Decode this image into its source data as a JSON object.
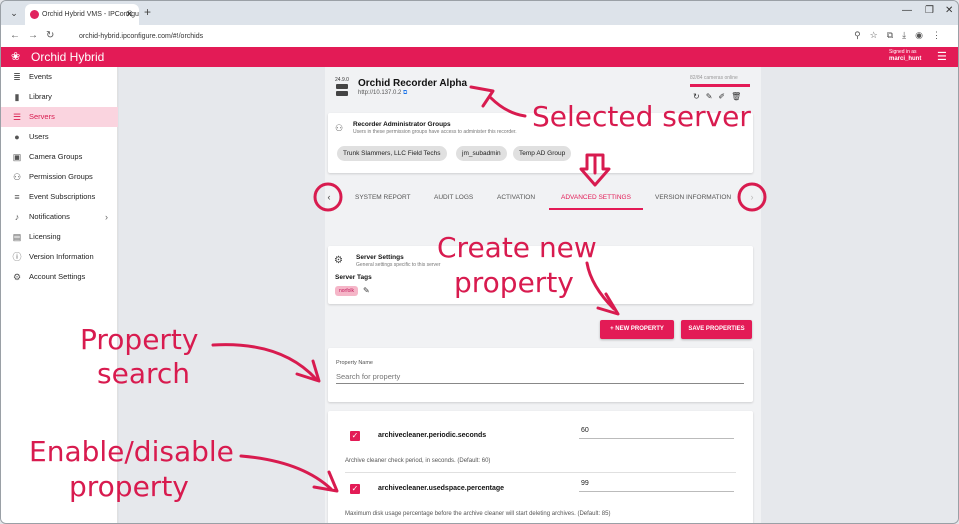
{
  "browser": {
    "tab_title": "Orchid Hybrid VMS - IPConfigu",
    "url": "orchid-hybrid.ipconfigure.com/#!/orchids"
  },
  "app": {
    "title": "Orchid Hybrid",
    "signed_in_label": "Signed in as",
    "user": "marci_hunt"
  },
  "sidebar": {
    "items": [
      {
        "label": "Events",
        "icon": "events-icon"
      },
      {
        "label": "Library",
        "icon": "bookmark-icon"
      },
      {
        "label": "Servers",
        "icon": "servers-icon",
        "active": true
      },
      {
        "label": "Users",
        "icon": "user-icon"
      },
      {
        "label": "Camera Groups",
        "icon": "camera-group-icon"
      },
      {
        "label": "Permission Groups",
        "icon": "permission-group-icon"
      },
      {
        "label": "Event Subscriptions",
        "icon": "event-subscription-icon"
      },
      {
        "label": "Notifications",
        "icon": "bell-icon"
      },
      {
        "label": "Licensing",
        "icon": "license-icon"
      },
      {
        "label": "Version Information",
        "icon": "info-icon"
      },
      {
        "label": "Account Settings",
        "icon": "account-settings-icon"
      }
    ]
  },
  "server": {
    "version": "24.9.0",
    "name": "Orchid Recorder Alpha",
    "url": "http://10.137.0.2",
    "cameras_online": "82/84 cameras online"
  },
  "admin_groups": {
    "title": "Recorder Administrator Groups",
    "subtitle": "Users in these permission groups have access to administer this recorder.",
    "chips": [
      "Trunk Slammers, LLC Field Techs",
      "jm_subadmin",
      "Temp AD Group"
    ]
  },
  "tabs": [
    {
      "label": "SYSTEM REPORT"
    },
    {
      "label": "AUDIT LOGS"
    },
    {
      "label": "ACTIVATION"
    },
    {
      "label": "ADVANCED SETTINGS",
      "active": true
    },
    {
      "label": "VERSION INFORMATION"
    }
  ],
  "server_settings": {
    "title": "Server Settings",
    "subtitle": "General settings specific to this server",
    "tags_label": "Server Tags",
    "tag": "norfolk"
  },
  "buttons": {
    "new_property": "+ NEW PROPERTY",
    "save_properties": "SAVE PROPERTIES"
  },
  "search": {
    "label": "Property Name",
    "placeholder": "Search for property"
  },
  "properties": [
    {
      "name": "archivecleaner.periodic.seconds",
      "value": "60",
      "description": "Archive cleaner check period, in seconds. (Default: 60)",
      "enabled": true
    },
    {
      "name": "archivecleaner.usedspace.percentage",
      "value": "99",
      "description": "Maximum disk usage percentage before the archive cleaner will start deleting archives. (Default: 85)",
      "enabled": true
    }
  ],
  "annotations": {
    "selected_server": "Selected server",
    "create_new_1": "Create new",
    "create_new_2": "property",
    "property_1": "Property",
    "property_2": "search",
    "enable_1": "Enable/disable",
    "enable_2": "property",
    "color": "#d81b4f"
  }
}
